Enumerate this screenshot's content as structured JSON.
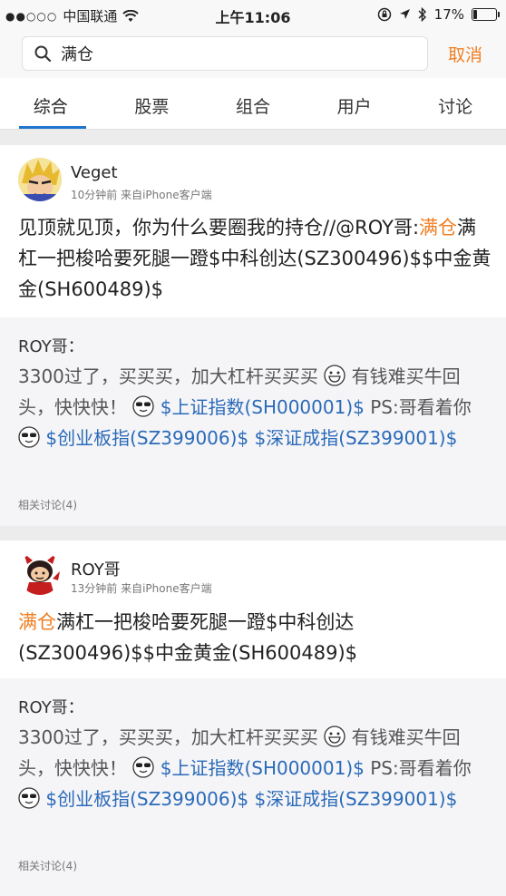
{
  "status": {
    "carrier": "中国联通",
    "time": "上午11:06",
    "battery": "17%",
    "battery_level": 0.17
  },
  "search": {
    "value": "满仓",
    "cancel_label": "取消"
  },
  "tabs": [
    {
      "label": "综合",
      "active": true
    },
    {
      "label": "股票"
    },
    {
      "label": "组合"
    },
    {
      "label": "用户"
    },
    {
      "label": "讨论"
    }
  ],
  "posts": [
    {
      "user": "Veget",
      "meta": "10分钟前   来自iPhone客户端",
      "content": {
        "p1": "见顶就见顶，你为什么要圈我的持仓//@ROY哥:",
        "hl": "满仓",
        "p2": "满杠一把梭哈要死腿一蹬$中科创达(SZ300496)$$中金黄金(SH600489)$"
      },
      "quote": {
        "author": "ROY哥：",
        "t1": "3300过了，买买买，加大杠杆买买买",
        "t2": "有钱难买牛回头，快快快！",
        "s1": "$上证指数(SH000001)$",
        "t3": " PS:哥看着你",
        "s2": "$创业板指(SZ399006)$",
        "s3": "$深证成指(SZ399001)$",
        "related": "相关讨论(4)"
      }
    },
    {
      "user": "ROY哥",
      "meta": "13分钟前   来自iPhone客户端",
      "content": {
        "hl": "满仓",
        "p2": "满杠一把梭哈要死腿一蹬$中科创达(SZ300496)$$中金黄金(SH600489)$"
      },
      "quote": {
        "author": "ROY哥：",
        "t1": "3300过了，买买买，加大杠杆买买买",
        "t2": "有钱难买牛回头，快快快！",
        "s1": "$上证指数(SH000001)$",
        "t3": " PS:哥看着你",
        "s2": "$创业板指(SZ399006)$",
        "s3": "$深证成指(SZ399001)$",
        "related": "相关讨论(4)"
      }
    }
  ],
  "colors": {
    "accent": "#ef7f23",
    "link": "#2a6ab8",
    "tab_indicator": "#1f74cc"
  }
}
